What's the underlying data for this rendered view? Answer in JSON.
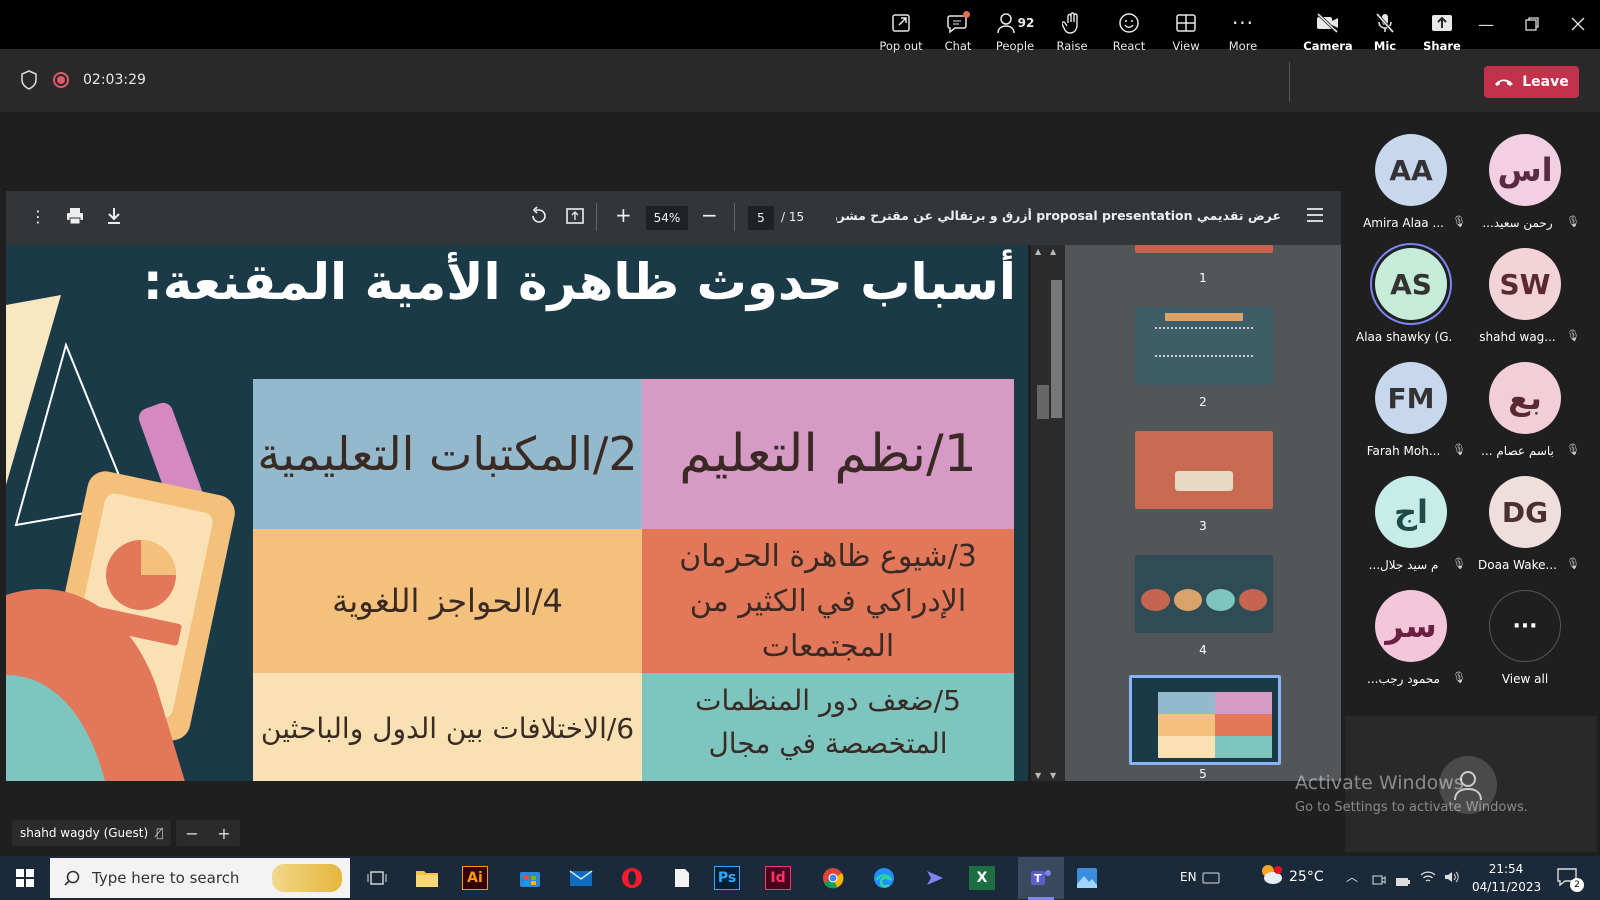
{
  "meeting": {
    "timer": "02:03:29",
    "toolbar": [
      {
        "id": "pop-out",
        "label": "Pop out",
        "icon": "pop-out-icon"
      },
      {
        "id": "chat",
        "label": "Chat",
        "icon": "chat-icon"
      },
      {
        "id": "people",
        "label": "People",
        "icon": "people-icon",
        "count": "92"
      },
      {
        "id": "raise",
        "label": "Raise",
        "icon": "hand-icon"
      },
      {
        "id": "react",
        "label": "React",
        "icon": "smiley-icon"
      },
      {
        "id": "view",
        "label": "View",
        "icon": "view-icon"
      },
      {
        "id": "more",
        "label": "More",
        "icon": "more-icon"
      },
      {
        "id": "camera",
        "label": "Camera",
        "icon": "camera-off-icon"
      },
      {
        "id": "mic",
        "label": "Mic",
        "icon": "mic-off-icon"
      },
      {
        "id": "share",
        "label": "Share",
        "icon": "share-icon"
      }
    ],
    "leave_label": "Leave",
    "colors": {
      "leave": "#c4314b",
      "accent": "#6264a7"
    }
  },
  "pdf": {
    "title": "عرض تقديمي proposal presentation أزرق و برتقالي عن مقترح مشروع",
    "zoom": "54%",
    "page": "5",
    "total_pages": "/ 15",
    "thumbnails": [
      "1",
      "2",
      "3",
      "4",
      "5"
    ]
  },
  "slide": {
    "heading": "أسباب حدوث ظاهرة الأمية المقنعة:",
    "cells": [
      {
        "text": "1/نظم التعليم",
        "color": "#d79ac6"
      },
      {
        "text": "2/المكتبات التعليمية",
        "color": "#94b8cc"
      },
      {
        "text": "3/شيوع ظاهرة الحرمان الإدراكي في الكثير من المجتمعات",
        "color": "#e2775a"
      },
      {
        "text": "4/الحواجز اللغوية",
        "color": "#f4c17c"
      },
      {
        "text": "5/ضعف دور المنظمات المتخصصة في مجال",
        "color": "#7ec4bf"
      },
      {
        "text": "6/الاختلافات بين الدول والباحثين",
        "color": "#f9e1b4"
      }
    ]
  },
  "participants": [
    {
      "initials": "AA",
      "name": "Amira Alaa ...",
      "color": "#c7d7ee"
    },
    {
      "initials": "اس",
      "name": "...رحمن سعيد",
      "color": "#f2cfe2"
    },
    {
      "initials": "AS",
      "name": "Alaa shawky (G...",
      "color": "#c6ecd9"
    },
    {
      "initials": "SW",
      "name": "shahd wag...",
      "color": "#f2d3d8"
    },
    {
      "initials": "FM",
      "name": "Farah Moh...",
      "color": "#c7d7ee"
    },
    {
      "initials": "بع",
      "name": "... باسم عصام",
      "color": "#f2cfd8"
    },
    {
      "initials": "اج",
      "name": "...م سيد جلال",
      "color": "#c8ece8"
    },
    {
      "initials": "DG",
      "name": "Doaa Wake...",
      "color": "#efdede"
    },
    {
      "initials": "سر",
      "name": "...محمود رجب",
      "color": "#f4c6da"
    }
  ],
  "view_all_label": "View all",
  "self_view": {
    "name": "shahd wagdy (Guest)"
  },
  "watermark": {
    "line1": "Activate Windows",
    "line2": "Go to Settings to activate Windows."
  },
  "taskbar": {
    "search_placeholder": "Type here to search",
    "lang": "EN",
    "temperature": "25°C",
    "time": "21:54",
    "date": "04/11/2023",
    "notifications": "2"
  }
}
